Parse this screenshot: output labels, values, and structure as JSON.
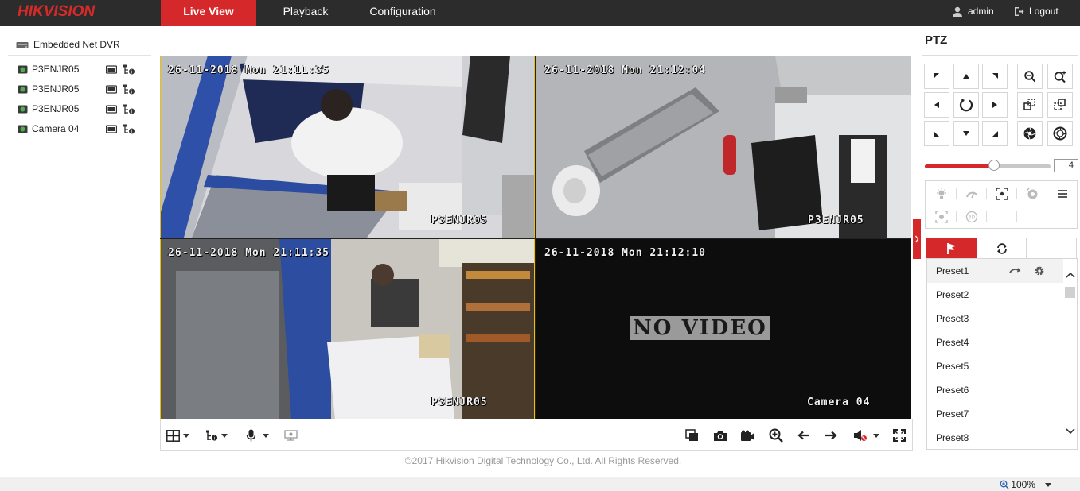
{
  "app": {
    "logo": "HIKVISION"
  },
  "nav": {
    "tabs": [
      {
        "label": "Live View",
        "active": true
      },
      {
        "label": "Playback"
      },
      {
        "label": "Configuration"
      }
    ],
    "user": "admin",
    "logout": "Logout"
  },
  "tree": {
    "root": "Embedded Net DVR",
    "cameras": [
      {
        "label": "P3ENJR05"
      },
      {
        "label": "P3ENJR05"
      },
      {
        "label": "P3ENJR05"
      },
      {
        "label": "Camera 04"
      }
    ]
  },
  "video": {
    "tiles": [
      {
        "timestamp": "26-11-2018 Mon 21:11:35",
        "name": "P3ENJR05"
      },
      {
        "timestamp": "26-11-2018 Mon 21:12:04",
        "name": "P3ENJR05"
      },
      {
        "timestamp": "26-11-2018 Mon 21:11:35",
        "name": "P3ENJR05"
      },
      {
        "timestamp": "26-11-2018 Mon 21:12:10",
        "name": "Camera 04",
        "overlay": "NO VIDEO"
      }
    ]
  },
  "toolbar": {
    "left_icons": [
      "window-layout-icon",
      "stream-type-icon",
      "microphone-icon",
      "digital-ptz-icon"
    ],
    "right_icons": [
      "stop-all-icon",
      "capture-icon",
      "record-icon",
      "zoom-in-icon",
      "prev-page-icon",
      "next-page-icon",
      "volume-muted-icon",
      "fullscreen-icon"
    ]
  },
  "footer": "©2017 Hikvision Digital Technology Co., Ltd. All Rights Reserved.",
  "ptz": {
    "title": "PTZ",
    "speed": "4",
    "speed_level": 0.55,
    "preset_tabs": [
      "preset-flag-icon",
      "patrol-icon",
      ""
    ],
    "presets": [
      "Preset1",
      "Preset2",
      "Preset3",
      "Preset4",
      "Preset5",
      "Preset6",
      "Preset7",
      "Preset8"
    ]
  },
  "status": {
    "zoom": "100%"
  },
  "colors": {
    "accent": "#d5282a",
    "topbar": "#2c2c2c",
    "selected_border": "#f0c000"
  }
}
